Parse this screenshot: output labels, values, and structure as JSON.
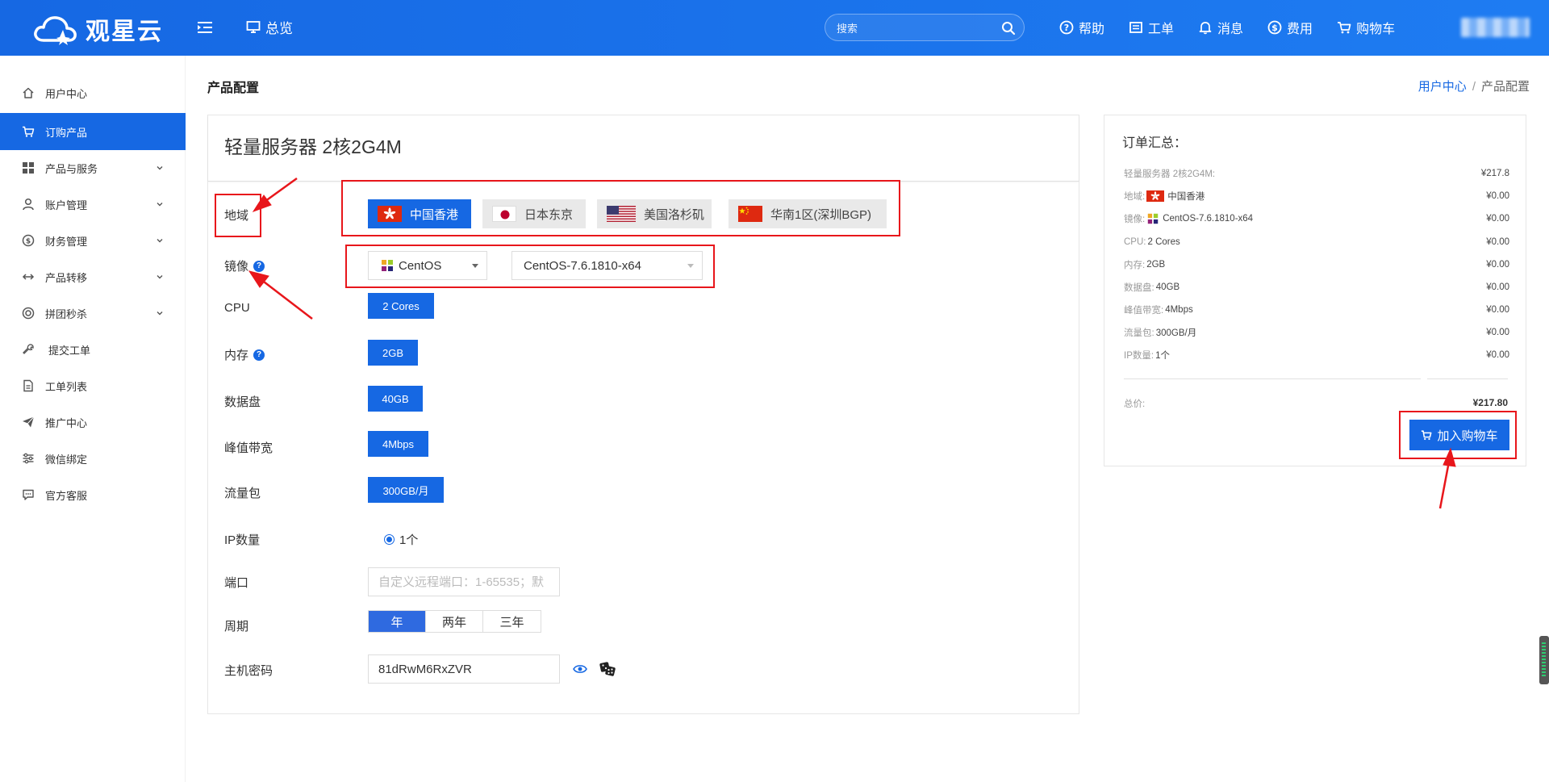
{
  "header": {
    "logo_text": "观星云",
    "overview_label": "总览",
    "search_placeholder": "搜索",
    "nav": [
      {
        "label": "帮助",
        "icon": "help-icon"
      },
      {
        "label": "工单",
        "icon": "ticket-icon"
      },
      {
        "label": "消息",
        "icon": "bell-icon"
      },
      {
        "label": "费用",
        "icon": "dollar-icon"
      },
      {
        "label": "购物车",
        "icon": "cart-icon"
      }
    ]
  },
  "sidebar": {
    "items": [
      {
        "label": "用户中心",
        "icon": "home-icon",
        "expandable": false,
        "active": false
      },
      {
        "label": "订购产品",
        "icon": "cart-icon",
        "expandable": false,
        "active": true
      },
      {
        "label": "产品与服务",
        "icon": "grid-icon",
        "expandable": true,
        "active": false
      },
      {
        "label": "账户管理",
        "icon": "user-icon",
        "expandable": true,
        "active": false
      },
      {
        "label": "财务管理",
        "icon": "dollar-icon",
        "expandable": true,
        "active": false
      },
      {
        "label": "产品转移",
        "icon": "transfer-icon",
        "expandable": true,
        "active": false
      },
      {
        "label": "拼团秒杀",
        "icon": "group-icon",
        "expandable": true,
        "active": false
      },
      {
        "label": "提交工单",
        "icon": "wrench-icon",
        "expandable": false,
        "active": false
      },
      {
        "label": "工单列表",
        "icon": "document-icon",
        "expandable": false,
        "active": false
      },
      {
        "label": "推广中心",
        "icon": "send-icon",
        "expandable": false,
        "active": false
      },
      {
        "label": "微信绑定",
        "icon": "sliders-icon",
        "expandable": false,
        "active": false
      },
      {
        "label": "官方客服",
        "icon": "chat-icon",
        "expandable": false,
        "active": false
      }
    ]
  },
  "page": {
    "title": "产品配置",
    "breadcrumb": {
      "home": "用户中心",
      "separator": "/",
      "current": "产品配置"
    }
  },
  "config": {
    "product_name": "轻量服务器 2核2G4M",
    "labels": {
      "region": "地域",
      "image": "镜像",
      "cpu": "CPU",
      "memory": "内存",
      "disk": "数据盘",
      "bandwidth": "峰值带宽",
      "traffic": "流量包",
      "ip_count": "IP数量",
      "port": "端口",
      "period": "周期",
      "password": "主机密码"
    },
    "regions": [
      {
        "label": "中国香港",
        "flag": "hk-flag",
        "active": true
      },
      {
        "label": "日本东京",
        "flag": "jp-flag",
        "active": false
      },
      {
        "label": "美国洛杉矶",
        "flag": "us-flag",
        "active": false
      },
      {
        "label": "华南1区(深圳BGP)",
        "flag": "cn-flag",
        "active": false
      }
    ],
    "os": "CentOS",
    "os_version": "CentOS-7.6.1810-x64",
    "cpu_value": "2 Cores",
    "memory_value": "2GB",
    "disk_value": "40GB",
    "bandwidth_value": "4Mbps",
    "traffic_value": "300GB/月",
    "ip_value": "1个",
    "port_placeholder": "自定义远程端口：1-65535；默",
    "periods": [
      {
        "label": "年",
        "active": true
      },
      {
        "label": "两年",
        "active": false
      },
      {
        "label": "三年",
        "active": false
      }
    ],
    "password_value": "81dRwM6RxZVR"
  },
  "summary": {
    "title": "订单汇总：",
    "rows": [
      {
        "label": "轻量服务器 2核2G4M:",
        "value": "",
        "icon": "",
        "price": "¥217.8"
      },
      {
        "label": "地域:",
        "value": "中国香港",
        "icon": "hk-flag",
        "price": "¥0.00"
      },
      {
        "label": "镜像:",
        "value": "CentOS-7.6.1810-x64",
        "icon": "centos-icon",
        "price": "¥0.00"
      },
      {
        "label": "CPU:",
        "value": "2 Cores",
        "icon": "",
        "price": "¥0.00"
      },
      {
        "label": "内存:",
        "value": "2GB",
        "icon": "",
        "price": "¥0.00"
      },
      {
        "label": "数据盘:",
        "value": "40GB",
        "icon": "",
        "price": "¥0.00"
      },
      {
        "label": "峰值带宽:",
        "value": "4Mbps",
        "icon": "",
        "price": "¥0.00"
      },
      {
        "label": "流量包:",
        "value": "300GB/月",
        "icon": "",
        "price": "¥0.00"
      },
      {
        "label": "IP数量:",
        "value": "1个",
        "icon": "",
        "price": "¥0.00"
      }
    ],
    "total_label": "总价:",
    "total_price": "¥217.80",
    "add_to_cart_label": "加入购物车"
  },
  "colors": {
    "brand": "#1668e3",
    "annotation": "#e8161b"
  }
}
